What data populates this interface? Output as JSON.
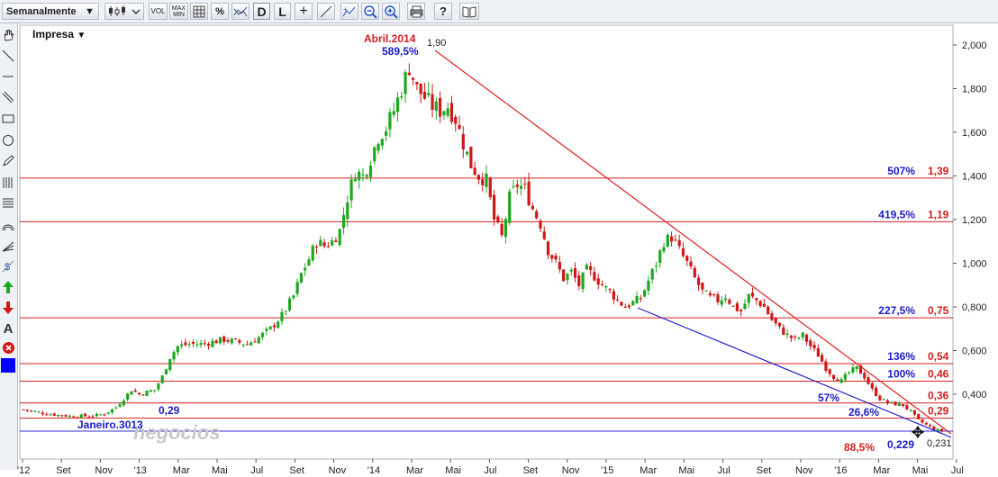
{
  "toolbar": {
    "period_select": "Semanalmente",
    "buttons": [
      "chart-type",
      "vol",
      "max-min",
      "grid",
      "percent",
      "compare",
      "daily",
      "log",
      "crosshair",
      "trendline-tool",
      "zoom-out",
      "zoom-in",
      "print",
      "help",
      "manual"
    ],
    "vol_label": "VOL",
    "maxmin_label": "MAX MIN",
    "percent_label": "%",
    "d_label": "D",
    "l_label": "L",
    "plus_label": "+",
    "help_label": "?"
  },
  "sidebar": {
    "tools": [
      "hand-icon",
      "line-icon",
      "horizontal-line-icon",
      "parallel-lines-icon",
      "rectangle-icon",
      "circle-icon",
      "pencil-icon",
      "fibonacci-icon",
      "grid-lines-icon",
      "arc-icon",
      "fan-icon",
      "dollar-icon",
      "up-arrow-icon",
      "down-arrow-icon",
      "text-icon",
      "delete-icon",
      "color-swatch-icon"
    ],
    "text_tool_label": "A",
    "swatch_color": "#0000ff"
  },
  "chart_data": {
    "type": "candlestick",
    "symbol": "Impresa",
    "yaxis_ticks": [
      "2,000",
      "1,800",
      "1,600",
      "1,400",
      "1,200",
      "1,000",
      "0,800",
      "0,600",
      "0,400"
    ],
    "yaxis_values": [
      2.0,
      1.8,
      1.6,
      1.4,
      1.2,
      1.0,
      0.8,
      0.6,
      0.4
    ],
    "xaxis_ticks": [
      "'12",
      "Set",
      "Nov",
      "'13",
      "Mar",
      "Mai",
      "Jul",
      "Set",
      "Nov",
      "'14",
      "Mar",
      "Mai",
      "Jul",
      "Set",
      "Nov",
      "'15",
      "Mar",
      "Mai",
      "Jul",
      "Set",
      "Nov",
      "'16",
      "Mar",
      "Mai",
      "Jul"
    ],
    "ylim": [
      0.2,
      2.05
    ],
    "close_path": [
      [
        0,
        0.33
      ],
      [
        3,
        0.32
      ],
      [
        6,
        0.31
      ],
      [
        9,
        0.305
      ],
      [
        12,
        0.3
      ],
      [
        15,
        0.3
      ],
      [
        18,
        0.3
      ],
      [
        21,
        0.31
      ],
      [
        24,
        0.34
      ],
      [
        26,
        0.38
      ],
      [
        28,
        0.42
      ],
      [
        30,
        0.4
      ],
      [
        32,
        0.41
      ],
      [
        34,
        0.42
      ],
      [
        36,
        0.48
      ],
      [
        38,
        0.57
      ],
      [
        40,
        0.62
      ],
      [
        43,
        0.63
      ],
      [
        46,
        0.63
      ],
      [
        49,
        0.64
      ],
      [
        52,
        0.65
      ],
      [
        55,
        0.64
      ],
      [
        58,
        0.63
      ],
      [
        61,
        0.66
      ],
      [
        64,
        0.7
      ],
      [
        67,
        0.76
      ],
      [
        70,
        0.85
      ],
      [
        72,
        0.95
      ],
      [
        74,
        1.02
      ],
      [
        76,
        1.1
      ],
      [
        78,
        1.08
      ],
      [
        80,
        1.1
      ],
      [
        82,
        1.15
      ],
      [
        84,
        1.3
      ],
      [
        86,
        1.42
      ],
      [
        88,
        1.4
      ],
      [
        90,
        1.48
      ],
      [
        92,
        1.58
      ],
      [
        94,
        1.62
      ],
      [
        96,
        1.7
      ],
      [
        98,
        1.8
      ],
      [
        100,
        1.9
      ],
      [
        102,
        1.8
      ],
      [
        104,
        1.76
      ],
      [
        106,
        1.72
      ],
      [
        108,
        1.7
      ],
      [
        110,
        1.72
      ],
      [
        112,
        1.66
      ],
      [
        114,
        1.55
      ],
      [
        116,
        1.45
      ],
      [
        118,
        1.4
      ],
      [
        120,
        1.38
      ],
      [
        122,
        1.2
      ],
      [
        124,
        1.12
      ],
      [
        126,
        1.3
      ],
      [
        128,
        1.36
      ],
      [
        130,
        1.34
      ],
      [
        132,
        1.25
      ],
      [
        134,
        1.18
      ],
      [
        136,
        1.06
      ],
      [
        138,
        1.0
      ],
      [
        140,
        0.93
      ],
      [
        142,
        0.96
      ],
      [
        144,
        0.9
      ],
      [
        146,
        0.97
      ],
      [
        148,
        0.94
      ],
      [
        150,
        0.9
      ],
      [
        152,
        0.87
      ],
      [
        154,
        0.83
      ],
      [
        156,
        0.8
      ],
      [
        158,
        0.82
      ],
      [
        160,
        0.84
      ],
      [
        162,
        0.92
      ],
      [
        164,
        1.0
      ],
      [
        166,
        1.1
      ],
      [
        168,
        1.12
      ],
      [
        170,
        1.06
      ],
      [
        172,
        1.0
      ],
      [
        174,
        0.93
      ],
      [
        176,
        0.87
      ],
      [
        178,
        0.84
      ],
      [
        180,
        0.83
      ],
      [
        182,
        0.85
      ],
      [
        184,
        0.8
      ],
      [
        186,
        0.78
      ],
      [
        188,
        0.85
      ],
      [
        190,
        0.83
      ],
      [
        192,
        0.8
      ],
      [
        194,
        0.74
      ],
      [
        196,
        0.7
      ],
      [
        198,
        0.67
      ],
      [
        200,
        0.65
      ],
      [
        202,
        0.67
      ],
      [
        204,
        0.62
      ],
      [
        206,
        0.58
      ],
      [
        208,
        0.52
      ],
      [
        210,
        0.48
      ],
      [
        212,
        0.46
      ],
      [
        214,
        0.5
      ],
      [
        216,
        0.52
      ],
      [
        218,
        0.48
      ],
      [
        220,
        0.42
      ],
      [
        222,
        0.38
      ],
      [
        224,
        0.36
      ],
      [
        226,
        0.355
      ],
      [
        228,
        0.35
      ],
      [
        230,
        0.32
      ],
      [
        232,
        0.28
      ],
      [
        234,
        0.26
      ],
      [
        236,
        0.24
      ],
      [
        238,
        0.231
      ]
    ],
    "horizontal_levels": [
      {
        "value": 1.39,
        "pct": "507%",
        "label": "1,39",
        "color": "#d42020"
      },
      {
        "value": 1.19,
        "pct": "419,5%",
        "label": "1,19",
        "color": "#d42020"
      },
      {
        "value": 0.75,
        "pct": "227,5%",
        "label": "0,75",
        "color": "#d42020"
      },
      {
        "value": 0.54,
        "pct": "136%",
        "label": "0,54",
        "color": "#d42020"
      },
      {
        "value": 0.46,
        "pct": "100%",
        "label": "0,46",
        "color": "#d42020"
      },
      {
        "value": 0.36,
        "pct": "",
        "label": "0,36",
        "color": "#d42020"
      },
      {
        "value": 0.29,
        "pct": "",
        "label": "0,29",
        "color": "#d42020"
      },
      {
        "value": 0.231,
        "pct": "",
        "label": "",
        "color": "#3030d0"
      }
    ],
    "annotations": {
      "peak_date": "Abril.2014",
      "peak_value": "1,90",
      "peak_pct": "589,5%",
      "low_date": "Janeiro.3013",
      "low_value": "0,29",
      "trend_pct_57": "57%",
      "trend_pct_266": "26,6%",
      "drop_pct": "88,5%",
      "current_value_1": "0,229",
      "current_value_2": "0,231"
    },
    "watermark": "negocios",
    "colors": {
      "up": "#1fa81f",
      "down": "#d01818",
      "resistance": "#e02020",
      "support": "#2020d0"
    }
  }
}
